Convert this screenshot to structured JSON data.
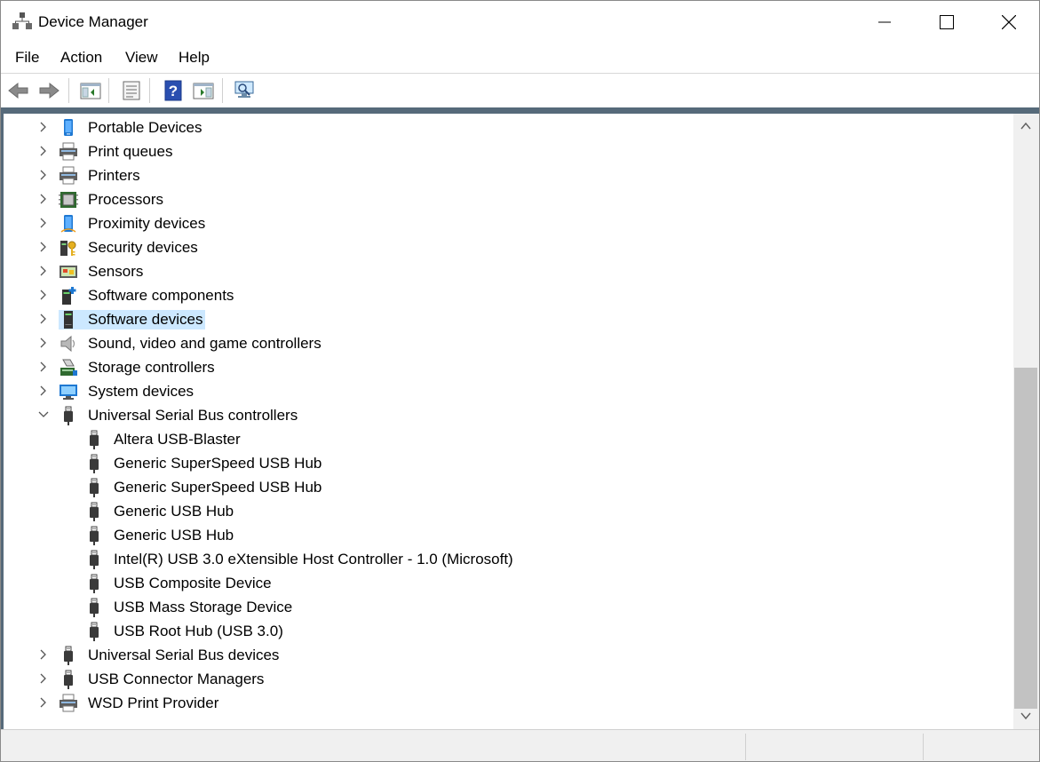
{
  "window": {
    "title": "Device Manager"
  },
  "menu": {
    "items": [
      "File",
      "Action",
      "View",
      "Help"
    ]
  },
  "toolbar": {
    "buttons": [
      "back-icon",
      "forward-icon",
      "show-hide-console-tree-icon",
      "properties-icon",
      "help-icon",
      "update-driver-icon",
      "scan-hardware-icon"
    ]
  },
  "tree": {
    "items": [
      {
        "label": "Portable Devices",
        "icon": "portable-device-icon",
        "expanded": false
      },
      {
        "label": "Print queues",
        "icon": "printer-icon",
        "expanded": false
      },
      {
        "label": "Printers",
        "icon": "printer-icon",
        "expanded": false
      },
      {
        "label": "Processors",
        "icon": "processor-icon",
        "expanded": false
      },
      {
        "label": "Proximity devices",
        "icon": "proximity-icon",
        "expanded": false
      },
      {
        "label": "Security devices",
        "icon": "security-icon",
        "expanded": false
      },
      {
        "label": "Sensors",
        "icon": "sensor-icon",
        "expanded": false
      },
      {
        "label": "Software components",
        "icon": "software-component-icon",
        "expanded": false
      },
      {
        "label": "Software devices",
        "icon": "software-device-icon",
        "expanded": false,
        "selected": true
      },
      {
        "label": "Sound, video and game controllers",
        "icon": "speaker-icon",
        "expanded": false
      },
      {
        "label": "Storage controllers",
        "icon": "storage-icon",
        "expanded": false
      },
      {
        "label": "System devices",
        "icon": "system-icon",
        "expanded": false
      },
      {
        "label": "Universal Serial Bus controllers",
        "icon": "usb-icon",
        "expanded": true,
        "children": [
          "Altera USB-Blaster",
          "Generic SuperSpeed USB Hub",
          "Generic SuperSpeed USB Hub",
          "Generic USB Hub",
          "Generic USB Hub",
          "Intel(R) USB 3.0 eXtensible Host Controller - 1.0 (Microsoft)",
          "USB Composite Device",
          "USB Mass Storage Device",
          "USB Root Hub (USB 3.0)"
        ]
      },
      {
        "label": "Universal Serial Bus devices",
        "icon": "usb-icon",
        "expanded": false
      },
      {
        "label": "USB Connector Managers",
        "icon": "usb-icon",
        "expanded": false
      },
      {
        "label": "WSD Print Provider",
        "icon": "printer-icon",
        "expanded": false
      }
    ]
  },
  "colors": {
    "selection": "#cce8ff",
    "frame": "#566a7a"
  }
}
